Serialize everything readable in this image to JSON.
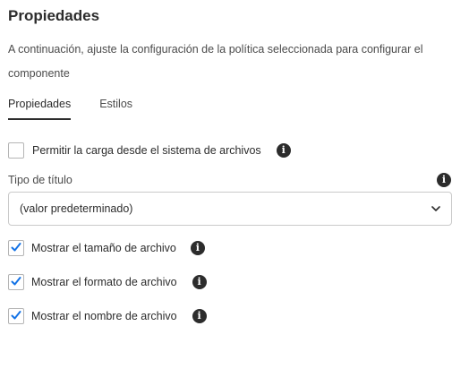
{
  "header": {
    "title": "Propiedades",
    "description": "A continuación, ajuste la configuración de la política seleccionada para configurar el componente"
  },
  "tabs": [
    {
      "label": "Propiedades",
      "active": true
    },
    {
      "label": "Estilos",
      "active": false
    }
  ],
  "upload_checkbox": {
    "label": "Permitir la carga desde el sistema de archivos",
    "checked": false
  },
  "title_type": {
    "label": "Tipo de título",
    "value": "(valor predeterminado)"
  },
  "checkboxes": [
    {
      "label": "Mostrar el tamaño de archivo",
      "checked": true
    },
    {
      "label": "Mostrar el formato de archivo",
      "checked": true
    },
    {
      "label": "Mostrar el nombre de archivo",
      "checked": true
    }
  ],
  "colors": {
    "check": "#1473e6",
    "text": "#2c2c2c",
    "border": "#cacaca"
  },
  "icons": {
    "info": "info-icon",
    "check": "checkmark-icon",
    "chevron": "chevron-down-icon"
  }
}
